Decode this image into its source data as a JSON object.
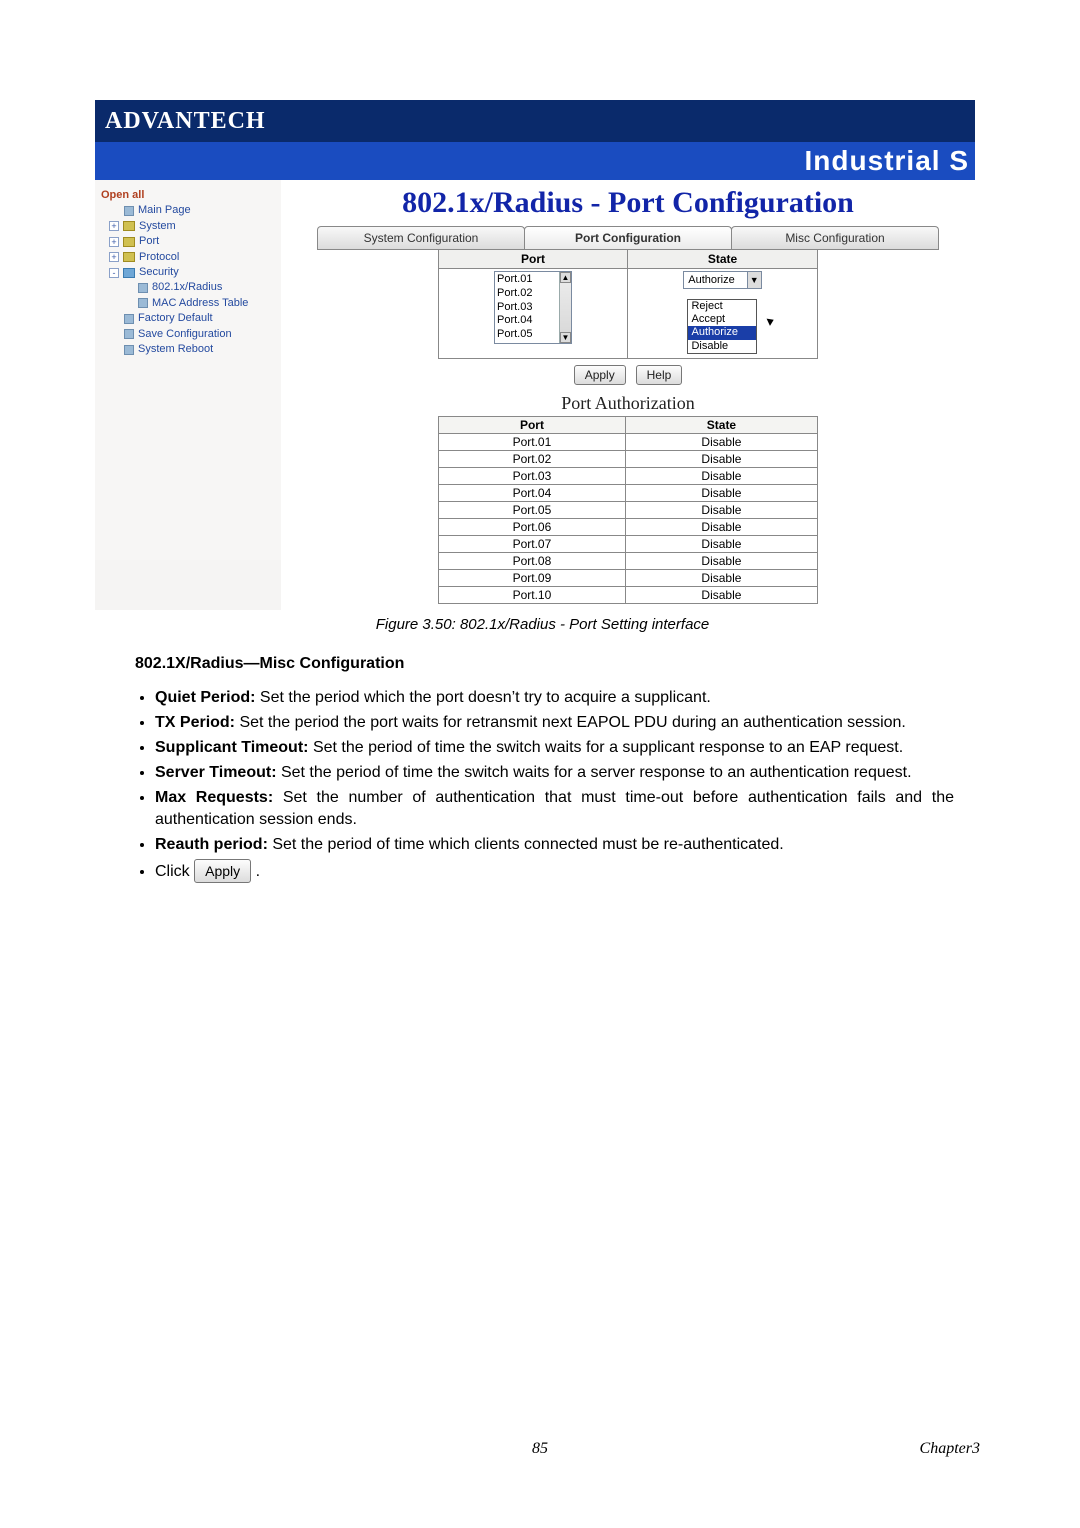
{
  "brand": "ADVANTECH",
  "product_banner": "Industrial S",
  "page_title": "802.1x/Radius - Port Configuration",
  "sidebar": {
    "open_all": "Open all",
    "items": [
      {
        "name": "main-page",
        "label": "Main Page",
        "level": 1,
        "expander": "",
        "iconClass": "leaf-ic"
      },
      {
        "name": "system",
        "label": "System",
        "level": 1,
        "expander": "+",
        "iconClass": "folder-ic"
      },
      {
        "name": "port",
        "label": "Port",
        "level": 1,
        "expander": "+",
        "iconClass": "folder-ic"
      },
      {
        "name": "protocol",
        "label": "Protocol",
        "level": 1,
        "expander": "+",
        "iconClass": "folder-ic"
      },
      {
        "name": "security",
        "label": "Security",
        "level": 1,
        "expander": "-",
        "iconClass": "folder-blue"
      },
      {
        "name": "8021x-radius",
        "label": "802.1x/Radius",
        "level": 2,
        "expander": "",
        "iconClass": "leaf-ic"
      },
      {
        "name": "mac-address-table",
        "label": "MAC Address Table",
        "level": 2,
        "expander": "",
        "iconClass": "leaf-ic"
      },
      {
        "name": "factory-default",
        "label": "Factory Default",
        "level": 1,
        "expander": "",
        "iconClass": "leaf-ic"
      },
      {
        "name": "save-config",
        "label": "Save Configuration",
        "level": 1,
        "expander": "",
        "iconClass": "leaf-ic"
      },
      {
        "name": "system-reboot",
        "label": "System Reboot",
        "level": 1,
        "expander": "",
        "iconClass": "leaf-ic"
      }
    ]
  },
  "tabs": [
    {
      "name": "tab-system-config",
      "label": "System Configuration",
      "active": false
    },
    {
      "name": "tab-port-config",
      "label": "Port Configuration",
      "active": true
    },
    {
      "name": "tab-misc-config",
      "label": "Misc Configuration",
      "active": false
    }
  ],
  "config_table": {
    "port_header": "Port",
    "state_header": "State",
    "port_options": [
      "Port.01",
      "Port.02",
      "Port.03",
      "Port.04",
      "Port.05"
    ],
    "state_selected": "Authorize",
    "state_dropdown": [
      {
        "label": "Reject",
        "selected": false
      },
      {
        "label": "Accept",
        "selected": false
      },
      {
        "label": "Authorize",
        "selected": true
      },
      {
        "label": "Disable",
        "selected": false
      }
    ],
    "apply_label": "Apply",
    "help_label": "Help"
  },
  "authorization": {
    "title": "Port Authorization",
    "port_header": "Port",
    "state_header": "State",
    "rows": [
      {
        "port": "Port.01",
        "state": "Disable"
      },
      {
        "port": "Port.02",
        "state": "Disable"
      },
      {
        "port": "Port.03",
        "state": "Disable"
      },
      {
        "port": "Port.04",
        "state": "Disable"
      },
      {
        "port": "Port.05",
        "state": "Disable"
      },
      {
        "port": "Port.06",
        "state": "Disable"
      },
      {
        "port": "Port.07",
        "state": "Disable"
      },
      {
        "port": "Port.08",
        "state": "Disable"
      },
      {
        "port": "Port.09",
        "state": "Disable"
      },
      {
        "port": "Port.10",
        "state": "Disable"
      }
    ]
  },
  "figure_caption": "Figure 3.50: 802.1x/Radius - Port Setting interface",
  "section_heading": "802.1X/Radius—Misc Configuration",
  "bullets": [
    {
      "term": "Quiet Period:",
      "desc": "Set the period which the port doesn’t try to acquire a supplicant."
    },
    {
      "term": "TX Period:",
      "desc": "Set the period the port waits for retransmit next EAPOL PDU during an authentication session."
    },
    {
      "term": "Supplicant Timeout:",
      "desc": "Set the period of time the switch waits for a supplicant response to an EAP request."
    },
    {
      "term": "Server Timeout:",
      "desc": "Set the period of time the switch waits for a server response to an authentication request."
    },
    {
      "term": "Max Requests:",
      "desc": "Set the number of authentication that must time-out before authentication fails and the authentication session ends."
    },
    {
      "term": "Reauth period:",
      "desc": "Set the period of time which clients connected must be re-authenticated."
    }
  ],
  "click_text": "Click",
  "click_button_label": "Apply",
  "click_trailing": ".",
  "page_number": "85",
  "chapter": "Chapter3"
}
